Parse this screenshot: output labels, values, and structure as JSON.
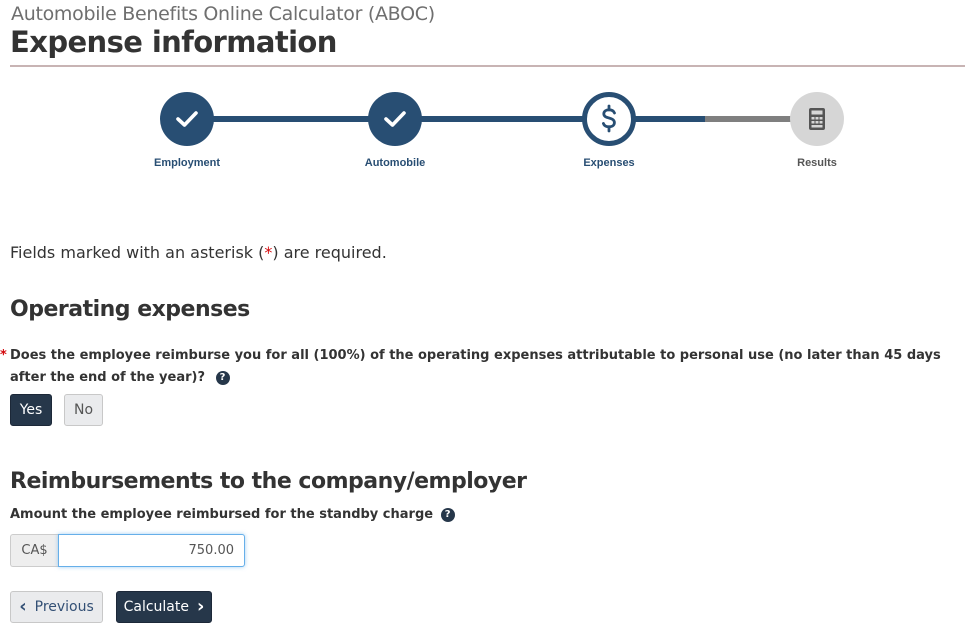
{
  "header": {
    "app_title": "Automobile Benefits Online Calculator (ABOC)",
    "page_title": "Expense information"
  },
  "stepper": {
    "steps": [
      {
        "label": "Employment",
        "status": "complete",
        "icon": "check-icon"
      },
      {
        "label": "Automobile",
        "status": "complete",
        "icon": "check-icon"
      },
      {
        "label": "Expenses",
        "status": "current",
        "icon": "dollar-icon"
      },
      {
        "label": "Results",
        "status": "pending",
        "icon": "calculator-icon"
      }
    ],
    "colors": {
      "complete": "#284e73",
      "pending": "#d6d6d6",
      "track_pending": "#7f7f7f"
    }
  },
  "form": {
    "required_note_before": "Fields marked with an asterisk (",
    "required_note_star": "*",
    "required_note_after": ") are required.",
    "operating": {
      "heading": "Operating expenses",
      "question_star": "*",
      "question": "Does the employee reimburse you for all (100%) of the operating expenses attributable to personal use (no later than 45 days after the end of the year)?",
      "help_icon": "?",
      "options": [
        "Yes",
        "No"
      ],
      "selected": "Yes"
    },
    "reimbursements": {
      "heading": "Reimbursements to the company/employer",
      "field_label": "Amount the employee reimbursed for the standby charge",
      "help_icon": "?",
      "currency_prefix": "CA$",
      "amount_value": "750.00"
    }
  },
  "actions": {
    "previous_label": "Previous",
    "previous_icon": "‹",
    "calculate_label": "Calculate",
    "calculate_icon": "›"
  }
}
